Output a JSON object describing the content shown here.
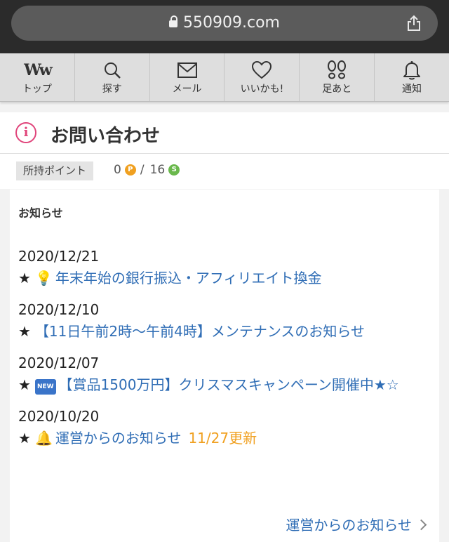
{
  "browser": {
    "url": "550909.com"
  },
  "nav": {
    "items": [
      {
        "label": "トップ",
        "icon": "ww-logo-icon",
        "logo_text": "Ww"
      },
      {
        "label": "探す",
        "icon": "search-icon"
      },
      {
        "label": "メール",
        "icon": "mail-icon"
      },
      {
        "label": "いいかも!",
        "icon": "heart-icon"
      },
      {
        "label": "足あと",
        "icon": "footprints-icon"
      },
      {
        "label": "通知",
        "icon": "bell-icon"
      }
    ]
  },
  "page": {
    "title": "お問い合わせ",
    "icon": "info-icon",
    "accent": "#e0457b"
  },
  "points": {
    "label": "所持ポイント",
    "p_value": "0",
    "p_symbol": "P",
    "separator": "/",
    "s_value": "16",
    "s_symbol": "S"
  },
  "notices": {
    "title": "お知らせ",
    "items": [
      {
        "date": "2020/12/21",
        "star": "★",
        "badge": "💡",
        "text": "年末年始の銀行振込・アフィリエイト換金",
        "update": ""
      },
      {
        "date": "2020/12/10",
        "star": "★",
        "badge": "",
        "text": "【11日午前2時〜午前4時】メンテナンスのお知らせ",
        "update": ""
      },
      {
        "date": "2020/12/07",
        "star": "★",
        "badge": "NEW",
        "text": "【賞品1500万円】クリスマスキャンペーン開催中★☆",
        "update": ""
      },
      {
        "date": "2020/10/20",
        "star": "★",
        "badge": "🔔",
        "text": "運営からのお知らせ",
        "update": "11/27更新"
      }
    ],
    "more_label": "運営からのお知らせ"
  },
  "colors": {
    "link": "#2f6db5",
    "update": "#f0a020",
    "point_p": "#f0a020",
    "point_s": "#6ab84c"
  }
}
